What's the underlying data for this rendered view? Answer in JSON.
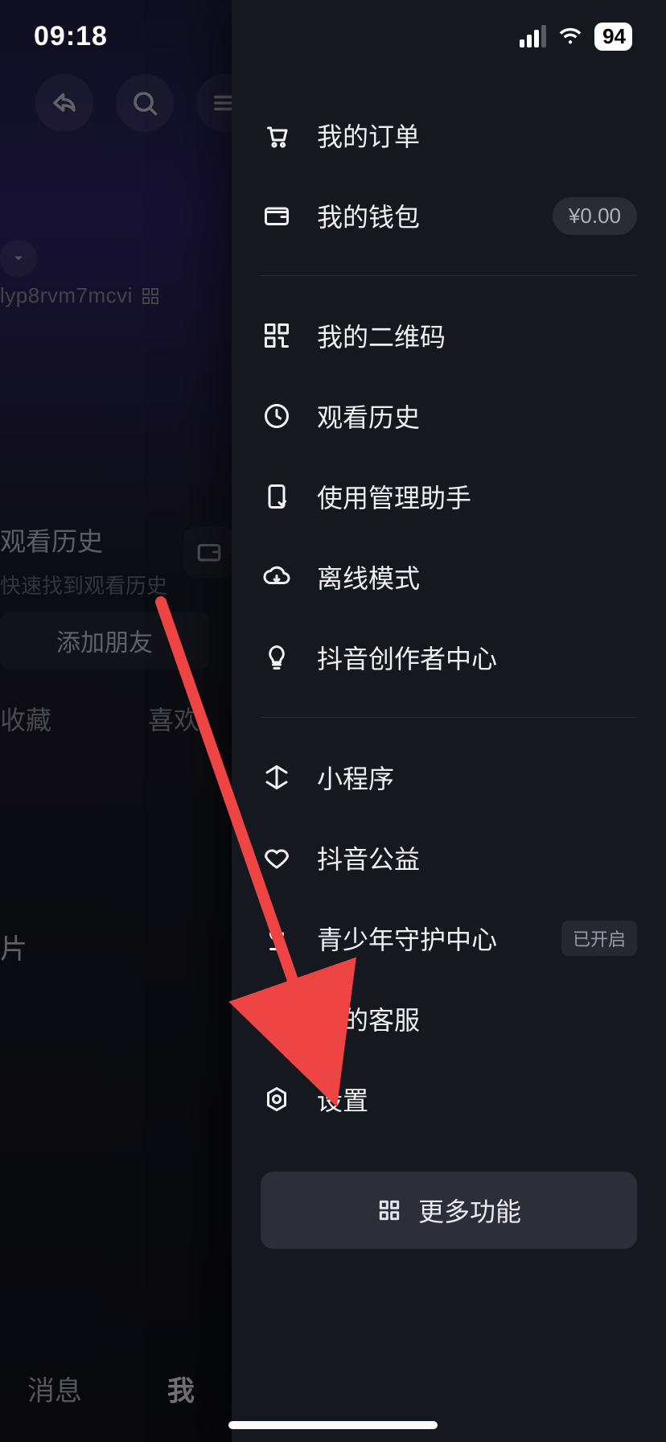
{
  "status": {
    "time": "09:18",
    "battery": "94"
  },
  "back": {
    "username": "lyp8rvm7mcvi",
    "history_title": "观看历史",
    "history_sub": "快速找到观看历史",
    "add_friend": "添加朋友",
    "tab_fav": "收藏",
    "tab_like": "喜欢",
    "pian": "片",
    "nav_msg": "消息",
    "nav_me": "我"
  },
  "drawer": {
    "orders": "我的订单",
    "wallet": "我的钱包",
    "wallet_value": "¥0.00",
    "qrcode": "我的二维码",
    "history": "观看历史",
    "usage": "使用管理助手",
    "offline": "离线模式",
    "creator": "抖音创作者中心",
    "miniapp": "小程序",
    "charity": "抖音公益",
    "youth": "青少年守护中心",
    "youth_tag": "已开启",
    "service": "我的客服",
    "settings": "设置",
    "more": "更多功能"
  }
}
